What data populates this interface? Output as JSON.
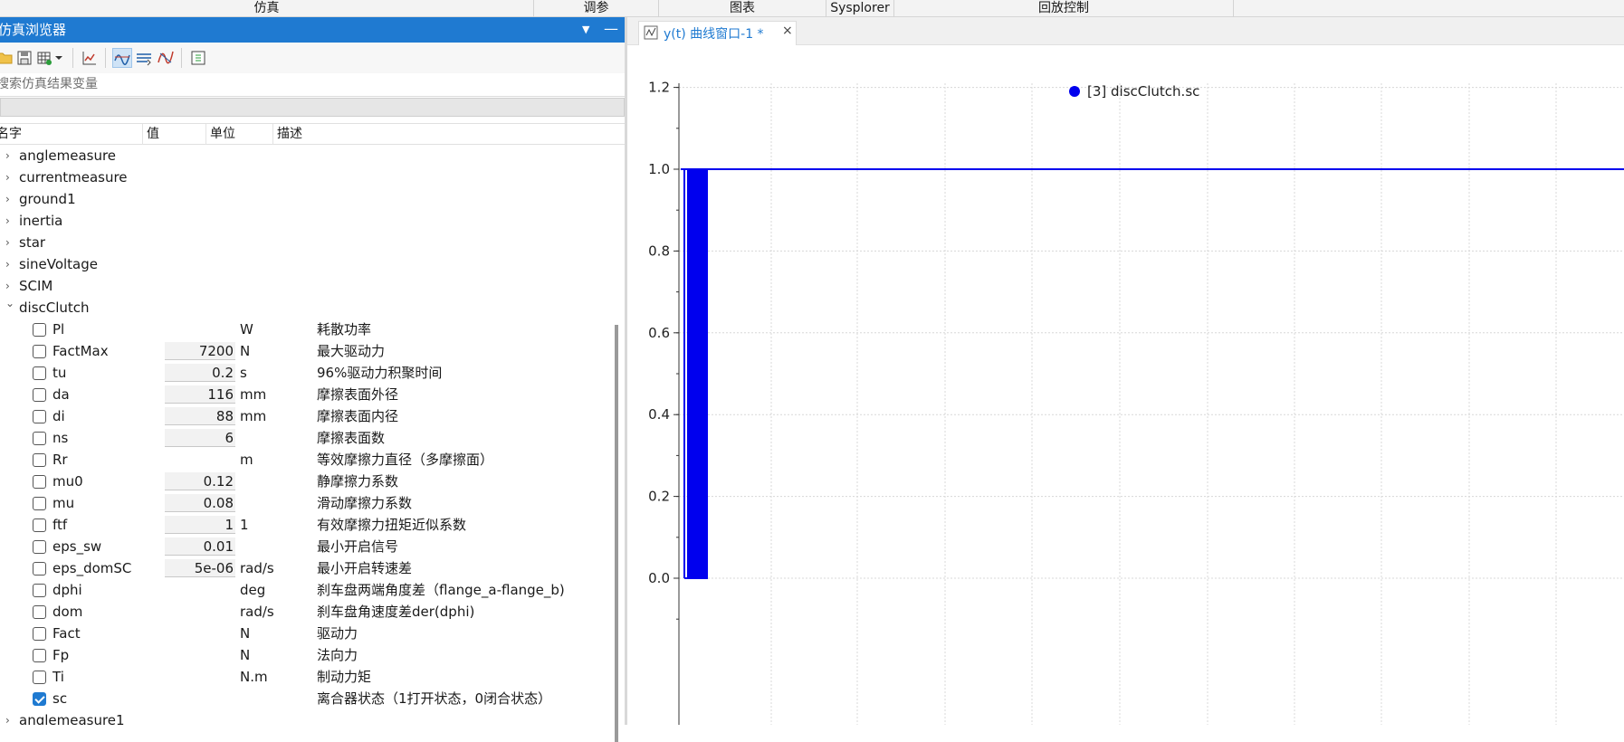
{
  "ribbon": {
    "tabs": [
      {
        "label": "仿真",
        "id": "sim"
      },
      {
        "label": "调参",
        "id": "tune"
      },
      {
        "label": "图表",
        "id": "chart"
      },
      {
        "label": "Sysplorer",
        "id": "sysplorer"
      },
      {
        "label": "回放控制",
        "id": "replay"
      }
    ]
  },
  "browser": {
    "title": "仿真浏览器",
    "search_placeholder": "搜索仿真结果变量",
    "columns": {
      "name": "名字",
      "value": "值",
      "unit": "单位",
      "desc": "描述"
    },
    "groups": [
      {
        "name": "anglemeasure",
        "expanded": false
      },
      {
        "name": "currentmeasure",
        "expanded": false
      },
      {
        "name": "ground1",
        "expanded": false
      },
      {
        "name": "inertia",
        "expanded": false
      },
      {
        "name": "star",
        "expanded": false
      },
      {
        "name": "sineVoltage",
        "expanded": false
      },
      {
        "name": "SCIM",
        "expanded": false
      },
      {
        "name": "discClutch",
        "expanded": true
      }
    ],
    "params": [
      {
        "name": "Pl",
        "value": "",
        "unit": "W",
        "desc": "耗散功率",
        "checked": false
      },
      {
        "name": "FactMax",
        "value": "7200",
        "unit": "N",
        "desc": "最大驱动力",
        "checked": false
      },
      {
        "name": "tu",
        "value": "0.2",
        "unit": "s",
        "desc": "96%驱动力积聚时间",
        "checked": false
      },
      {
        "name": "da",
        "value": "116",
        "unit": "mm",
        "desc": "摩擦表面外径",
        "checked": false
      },
      {
        "name": "di",
        "value": "88",
        "unit": "mm",
        "desc": "摩擦表面内径",
        "checked": false
      },
      {
        "name": "ns",
        "value": "6",
        "unit": "",
        "desc": "摩擦表面数",
        "checked": false
      },
      {
        "name": "Rr",
        "value": "",
        "unit": "m",
        "desc": "等效摩擦力直径（多摩擦面）",
        "checked": false
      },
      {
        "name": "mu0",
        "value": "0.12",
        "unit": "",
        "desc": "静摩擦力系数",
        "checked": false
      },
      {
        "name": "mu",
        "value": "0.08",
        "unit": "",
        "desc": "滑动摩擦力系数",
        "checked": false
      },
      {
        "name": "ftf",
        "value": "1",
        "unit": "1",
        "desc": "有效摩擦力扭矩近似系数",
        "checked": false
      },
      {
        "name": "eps_sw",
        "value": "0.01",
        "unit": "",
        "desc": "最小开启信号",
        "checked": false
      },
      {
        "name": "eps_domSC",
        "value": "5e-06",
        "unit": "rad/s",
        "desc": "最小开启转速差",
        "checked": false
      },
      {
        "name": "dphi",
        "value": "",
        "unit": "deg",
        "desc": "刹车盘两端角度差（flange_a-flange_b)",
        "checked": false
      },
      {
        "name": "dom",
        "value": "",
        "unit": "rad/s",
        "desc": "刹车盘角速度差der(dphi)",
        "checked": false
      },
      {
        "name": "Fact",
        "value": "",
        "unit": "N",
        "desc": "驱动力",
        "checked": false
      },
      {
        "name": "Fp",
        "value": "",
        "unit": "N",
        "desc": "法向力",
        "checked": false
      },
      {
        "name": "Ti",
        "value": "",
        "unit": "N.m",
        "desc": "制动力矩",
        "checked": false
      },
      {
        "name": "sc",
        "value": "",
        "unit": "",
        "desc": "离合器状态（1打开状态，0闭合状态）",
        "checked": true
      }
    ],
    "trailing_group": {
      "name": "anglemeasure1",
      "expanded": false
    }
  },
  "plot_window": {
    "tab_label": "y(t) 曲线窗口-1 *",
    "close_label": "×",
    "legend_marker": "●"
  },
  "chart_data": {
    "type": "line",
    "legend": [
      "[3] discClutch.sc"
    ],
    "series_color": "#0000ee",
    "ylim": [
      -0.1,
      1.25
    ],
    "yticks": [
      "1.2",
      "1.0",
      "0.8",
      "0.6",
      "0.4",
      "0.2",
      "0.0"
    ],
    "grid": true,
    "legend_position": "top-center",
    "series": [
      {
        "name": "[3] discClutch.sc",
        "segments": [
          {
            "note_x": "start",
            "y_from": 1.0,
            "y_to": 0.0
          },
          {
            "note_x": "after",
            "y": 1.0
          }
        ]
      }
    ]
  }
}
